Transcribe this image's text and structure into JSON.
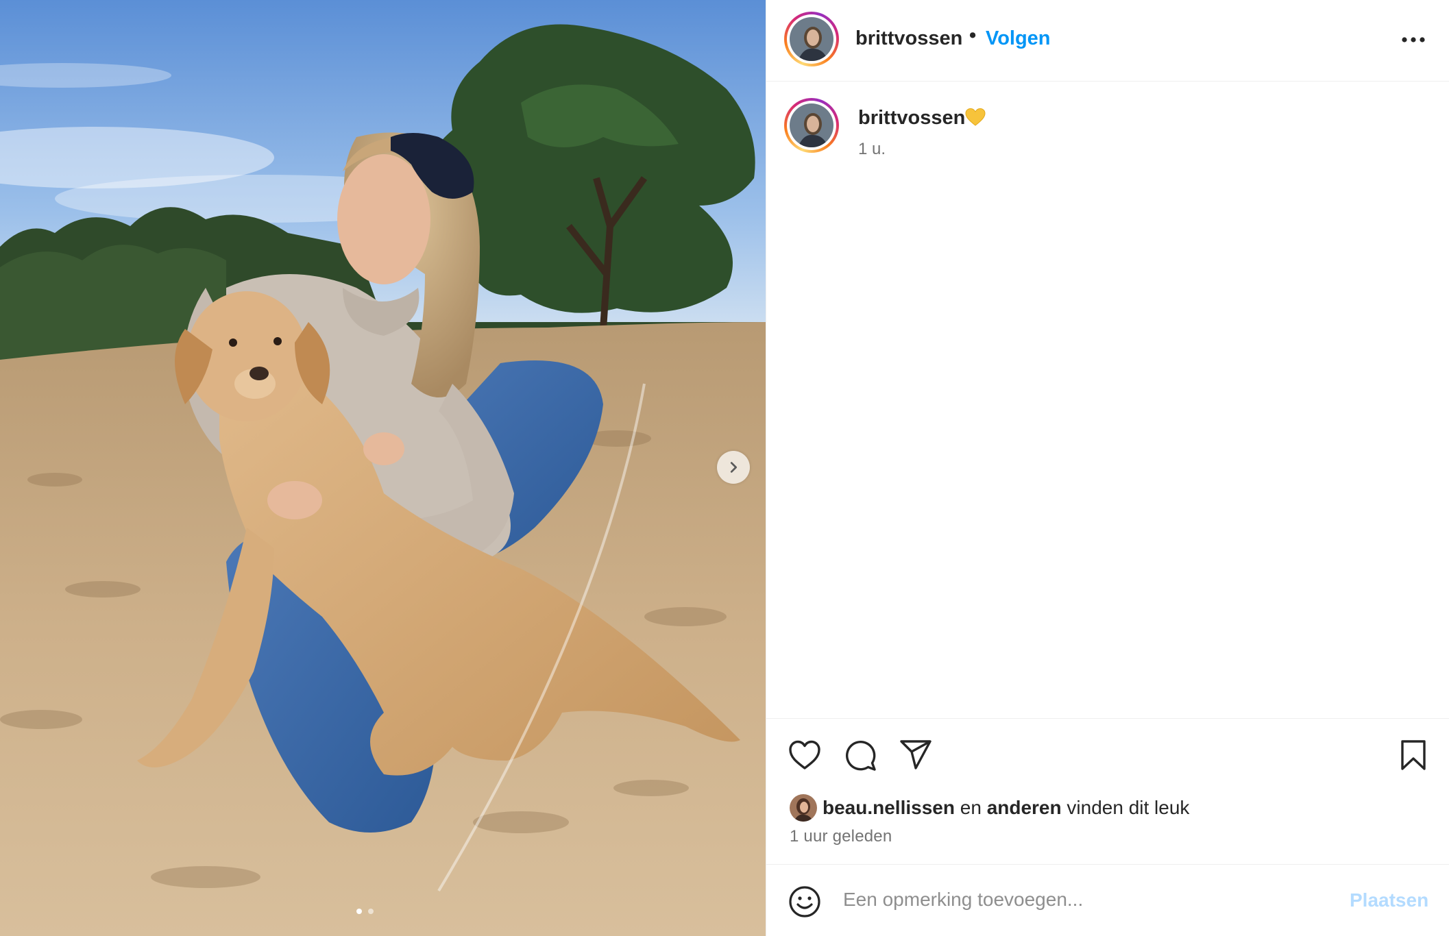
{
  "post": {
    "image_description_alt": "",
    "carousel_dots": 2,
    "active_dot": 0
  },
  "header": {
    "username": "brittvossen",
    "separator": "•",
    "follow_label": "Volgen"
  },
  "caption": {
    "username": "brittvossen",
    "emoji": "yellow-heart",
    "time": "1 u."
  },
  "likes": {
    "user": "beau.nellissen",
    "connector": "en",
    "others": "anderen",
    "suffix": "vinden dit leuk"
  },
  "timestamp": "1 uur geleden",
  "comment": {
    "placeholder": "Een opmerking toevoegen...",
    "post_label": "Plaatsen"
  },
  "colors": {
    "accent": "#0095f6",
    "post_disabled": "#b3dbff",
    "muted_text": "#737373"
  },
  "icons": [
    "more-options-icon",
    "heart-icon",
    "comment-icon",
    "share-icon",
    "bookmark-icon",
    "emoji-icon",
    "chevron-right-icon"
  ]
}
